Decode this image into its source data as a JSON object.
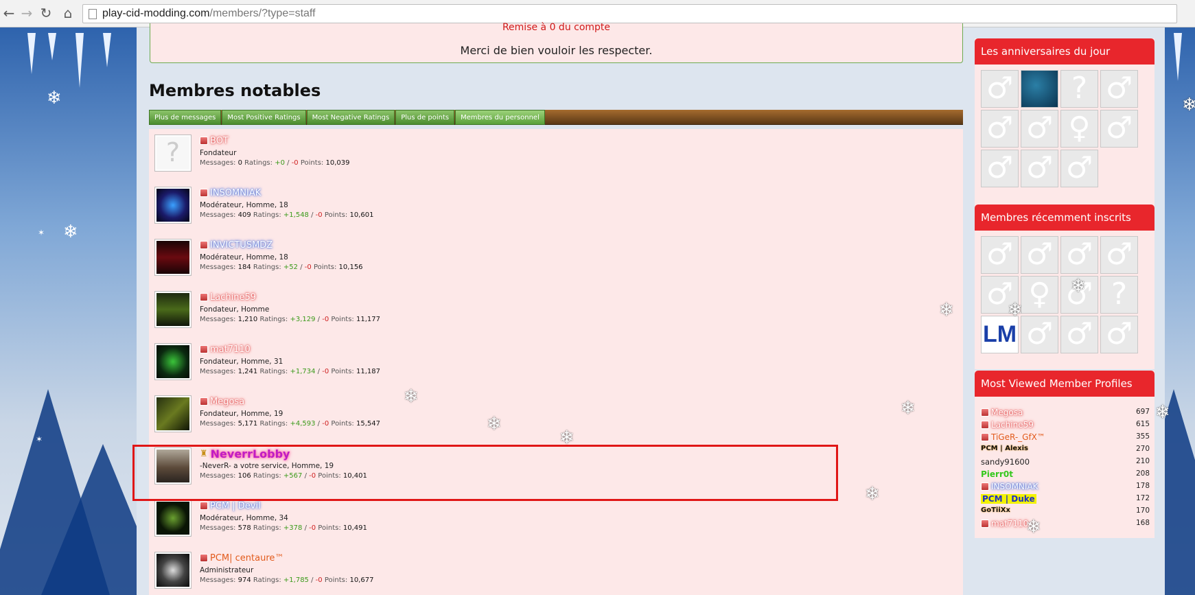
{
  "browser": {
    "url_domain": "play-cid-modding.com",
    "url_path": "/members/?type=staff",
    "back_icon": "←",
    "forward_icon": "→",
    "reload_icon": "↻",
    "home_icon": "⌂"
  },
  "notice": {
    "cut_text": "Remise à 0 du compte",
    "message": "Merci de bien vouloir les respecter."
  },
  "section_title": "Membres notables",
  "tabs": [
    "Plus de messages",
    "Most Positive Ratings",
    "Most Negative Ratings",
    "Plus de points",
    "Membres du personnel"
  ],
  "labels": {
    "messages": "Messages:",
    "ratings": "Ratings:",
    "points": "Points:",
    "slash": "/"
  },
  "members": [
    {
      "name": "BOT",
      "title": "Fondateur",
      "messages": "0",
      "pos": "+0",
      "neg": "-0",
      "points": "10,039"
    },
    {
      "name": "INSOMNIAK",
      "title": "Modérateur, Homme, 18",
      "messages": "409",
      "pos": "+1,548",
      "neg": "-0",
      "points": "10,601"
    },
    {
      "name": "INVICTUSMDZ",
      "title": "Modérateur, Homme, 18",
      "messages": "184",
      "pos": "+52",
      "neg": "-0",
      "points": "10,156"
    },
    {
      "name": "Lachine59",
      "title": "Fondateur, Homme",
      "messages": "1,210",
      "pos": "+3,129",
      "neg": "-0",
      "points": "11,177"
    },
    {
      "name": "mat7110",
      "title": "Fondateur, Homme, 31",
      "messages": "1,241",
      "pos": "+1,734",
      "neg": "-0",
      "points": "11,187"
    },
    {
      "name": "Megosa",
      "title": "Fondateur, Homme, 19",
      "messages": "5,171",
      "pos": "+4,593",
      "neg": "-0",
      "points": "15,547"
    },
    {
      "name": "NeverrLobby",
      "title": "-NeverR- a votre service, Homme, 19",
      "messages": "106",
      "pos": "+567",
      "neg": "-0",
      "points": "10,401"
    },
    {
      "name": "PCM | Devil",
      "title": "Modérateur, Homme, 34",
      "messages": "578",
      "pos": "+378",
      "neg": "-0",
      "points": "10,491"
    },
    {
      "name": "PCM| centaure™",
      "title": "Administrateur",
      "messages": "974",
      "pos": "+1,785",
      "neg": "-0",
      "points": "10,677"
    }
  ],
  "sidebar": {
    "birthdays_title": "Les anniversaires du jour",
    "recent_title": "Membres récemment inscrits",
    "most_viewed_title": "Most Viewed Member Profiles",
    "birthday_avatars": [
      "♂",
      "",
      "?",
      "♂",
      "♂",
      "♂",
      "♀",
      "♂",
      "♂",
      "♂",
      "♂"
    ],
    "recent_avatars": [
      "♂",
      "♂",
      "♂",
      "♂",
      "♂",
      "♀",
      "♂",
      "?",
      "LM",
      "♂",
      "♂",
      "♂"
    ],
    "most_viewed": [
      {
        "name": "Megosa",
        "count": "697"
      },
      {
        "name": "Lachine59",
        "count": "615"
      },
      {
        "name": "TiGeR-_GfX™",
        "count": "355"
      },
      {
        "name": "PCM | Alexis",
        "count": "270"
      },
      {
        "name": "sandy91600",
        "count": "210"
      },
      {
        "name": "Pierr0t",
        "count": "208"
      },
      {
        "name": "INSOMNIAK",
        "count": "178"
      },
      {
        "name": "PCM | Duke",
        "count": "172"
      },
      {
        "name": "GoTiiXx",
        "count": "170"
      },
      {
        "name": "mat7110",
        "count": "168"
      }
    ]
  },
  "colors": {
    "accent_red": "#e8262c",
    "tab_green": "#4b8c2f",
    "positive": "#3a9a1a",
    "negative": "#cf2020"
  }
}
